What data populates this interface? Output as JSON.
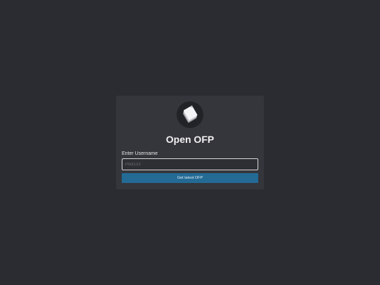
{
  "app": {
    "title": "Open OFP",
    "logo_icon": "paper-stack-icon"
  },
  "form": {
    "username_label": "Enter Username",
    "username_placeholder": "Pilot123",
    "username_value": "",
    "submit_label": "Get latest OFP"
  },
  "colors": {
    "background": "#2b2c31",
    "card": "#35363c",
    "accent": "#236a95"
  }
}
